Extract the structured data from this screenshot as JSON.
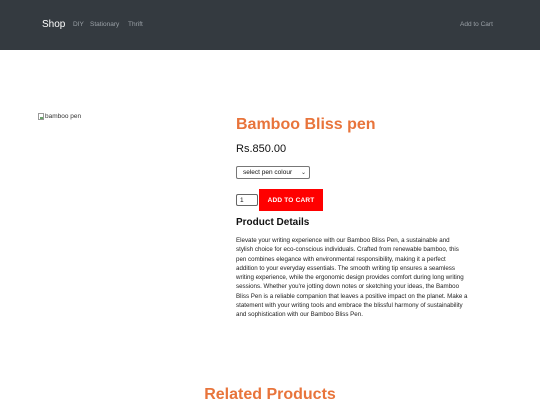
{
  "navbar": {
    "brand": "Shop",
    "links": [
      "DIY",
      "Stationary",
      "Thrift"
    ],
    "cart_link": "Add to Cart"
  },
  "product": {
    "image_alt": "bamboo pen",
    "title": "Bamboo Bliss pen",
    "price": "Rs.850.00",
    "colour_select": "select pen colour",
    "quantity": "1",
    "add_to_cart": "ADD TO CART",
    "details_heading": "Product Details",
    "description": "Elevate your writing experience with our Bamboo Bliss Pen, a sustainable and stylish choice for eco-conscious individuals. Crafted from renewable bamboo, this pen combines elegance with environmental responsibility, making it a perfect addition to your everyday essentials. The smooth writing tip ensures a seamless writing experience, while the ergonomic design provides comfort during long writing sessions. Whether you're jotting down notes or sketching your ideas, the Bamboo Bliss Pen is a reliable companion that leaves a positive impact on the planet. Make a statement with your writing tools and embrace the blissful harmony of sustainability and sophistication with our Bamboo Bliss Pen."
  },
  "related": {
    "heading": "Related Products"
  },
  "colors": {
    "navbar_bg": "#343a40",
    "accent_orange": "#e8743b",
    "button_red": "#ff0000"
  },
  "icons": {
    "product_image": "broken-image-icon",
    "select_arrow": "chevron-down-icon"
  }
}
